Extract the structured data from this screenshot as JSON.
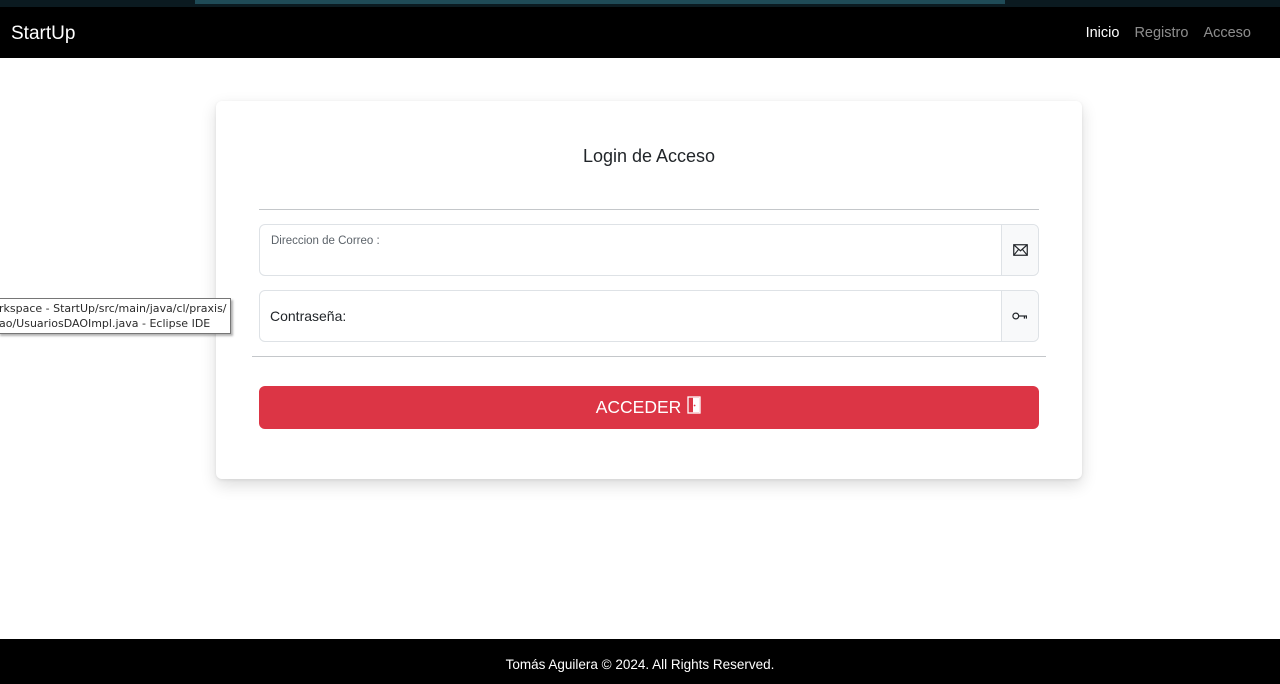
{
  "navbar": {
    "brand": "StartUp",
    "links": [
      {
        "label": "Inicio",
        "active": true
      },
      {
        "label": "Registro",
        "active": false
      },
      {
        "label": "Acceso",
        "active": false
      }
    ]
  },
  "login": {
    "title": "Login de Acceso",
    "email_label": "Direccion de Correo :",
    "email_value": "",
    "email_icon": "envelope-icon",
    "password_placeholder": "Contraseña:",
    "password_value": "",
    "password_icon": "key-icon",
    "submit_label": "ACCEDER",
    "submit_icon": "door-icon",
    "accent_color": "#dc3545"
  },
  "tooltip": {
    "line1": "rkspace - StartUp/src/main/java/cl/praxis/",
    "line2": "ao/UsuariosDAOImpl.java - Eclipse IDE"
  },
  "footer": {
    "text": "Tomás Aguilera © 2024. All Rights Reserved."
  }
}
